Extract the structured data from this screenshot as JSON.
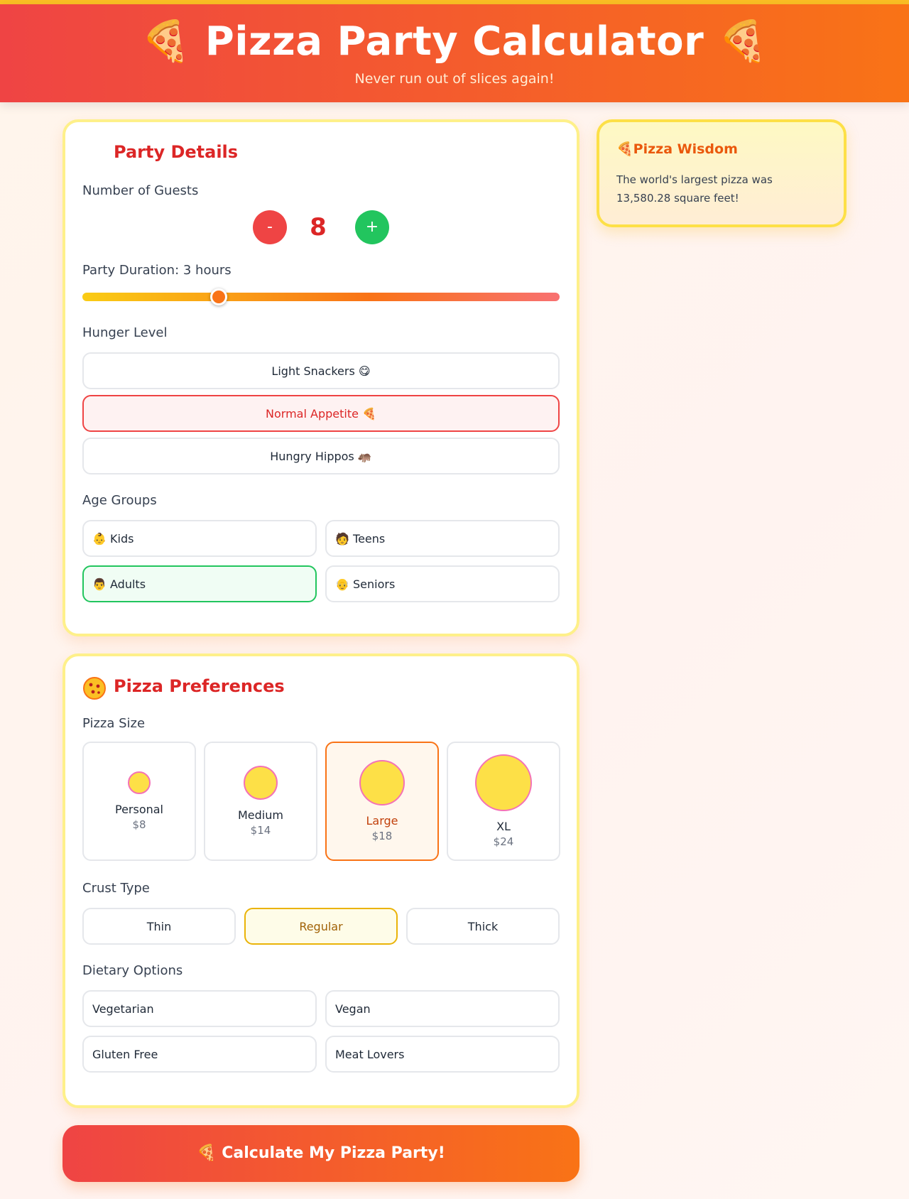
{
  "header": {
    "title": "🍕 Pizza Party Calculator 🍕",
    "subtitle": "Never run out of slices again!"
  },
  "party": {
    "title": "Party Details",
    "guests_label": "Number of Guests",
    "guests_value": "8",
    "minus_label": "-",
    "plus_label": "+",
    "duration_label": "Party Duration: 3 hours",
    "duration_hours": 3,
    "hunger_label": "Hunger Level",
    "hunger_options": [
      {
        "label": "Light Snackers 😋",
        "selected": false
      },
      {
        "label": "Normal Appetite 🍕",
        "selected": true
      },
      {
        "label": "Hungry Hippos 🦛",
        "selected": false
      }
    ],
    "age_label": "Age Groups",
    "age_options": [
      {
        "label": "👶 Kids",
        "selected": false
      },
      {
        "label": "🧑 Teens",
        "selected": false
      },
      {
        "label": "👨 Adults",
        "selected": true
      },
      {
        "label": "👴 Seniors",
        "selected": false
      }
    ]
  },
  "prefs": {
    "title": "Pizza Preferences",
    "size_label": "Pizza Size",
    "sizes": [
      {
        "name": "Personal",
        "price": "$8",
        "selected": false
      },
      {
        "name": "Medium",
        "price": "$14",
        "selected": false
      },
      {
        "name": "Large",
        "price": "$18",
        "selected": true
      },
      {
        "name": "XL",
        "price": "$24",
        "selected": false
      }
    ],
    "crust_label": "Crust Type",
    "crusts": [
      {
        "label": "Thin",
        "selected": false
      },
      {
        "label": "Regular",
        "selected": true
      },
      {
        "label": "Thick",
        "selected": false
      }
    ],
    "dietary_label": "Dietary Options",
    "dietary": [
      {
        "label": "Vegetarian"
      },
      {
        "label": "Vegan"
      },
      {
        "label": "Gluten Free"
      },
      {
        "label": "Meat Lovers"
      }
    ]
  },
  "calculate_label": "🍕 Calculate My Pizza Party!",
  "wisdom": {
    "title": "🍕Pizza Wisdom",
    "text": "The world's largest pizza was 13,580.28 square feet!"
  },
  "colors": {
    "accent_red": "#ef4444",
    "accent_orange": "#f97316",
    "plus_green": "#22c55e",
    "selected_red_bg": "#fef2f2",
    "selected_green_bg": "#f0fdf4",
    "selected_orange_bg": "#fff7ed",
    "selected_yellow_bg": "#fefce8"
  }
}
